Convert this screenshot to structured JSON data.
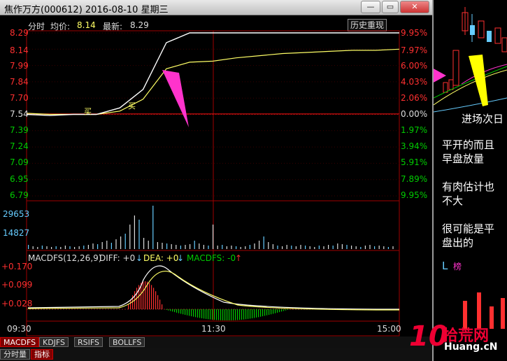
{
  "window": {
    "title": "焦作万方(000612) 2016-08-10 星期三",
    "minimize_label": "—",
    "restore_label": "▭",
    "close_label": "✕"
  },
  "header": {
    "label": "分时",
    "avg_label": "均价:",
    "avg_value": "8.14",
    "last_label": "最新:",
    "last_value": "8.29",
    "history_button": "历史重现"
  },
  "price_axis": {
    "left": [
      "8.29",
      "8.14",
      "7.99",
      "7.84",
      "7.70",
      "7.54",
      "7.39",
      "7.24",
      "7.09",
      "6.95",
      "6.79"
    ],
    "right": [
      "9.95%",
      "7.97%",
      "6.00%",
      "4.03%",
      "2.06%",
      "0.00%",
      "1.97%",
      "3.94%",
      "5.91%",
      "7.89%",
      "9.95%"
    ]
  },
  "volume_axis": [
    "29653",
    "14827"
  ],
  "macd": {
    "title": "MACDFS(12,26,9)",
    "diff_label": "DIFF: +0",
    "dea_label": "DEA: +0",
    "macdfs_label": "MACDFS: -0",
    "axis": [
      "+0.170",
      "+0.099",
      "+0.028"
    ]
  },
  "time_axis": [
    "09:30",
    "11:30",
    "15:00"
  ],
  "markers": [
    "买",
    "买"
  ],
  "indicator_tabs": [
    "MACDFS",
    "KDJFS",
    "RSIFS",
    "BOLLFS"
  ],
  "bottom_tabs": [
    "分时量",
    "指标"
  ],
  "annotations": {
    "entry_next_day": "进场次日",
    "flat_open_1": "平开的而且",
    "flat_open_2": "早盘放量",
    "meat_1": "有肉估计也",
    "meat_2": "不大",
    "likely_1": "很可能是平",
    "likely_2": "盘出的",
    "side_letter": "L",
    "side_tag": "榜"
  },
  "watermark": {
    "number": "10",
    "brand": "拾荒网",
    "site": "Huang.cN"
  },
  "colors": {
    "price_line": "#ffffff",
    "avg_line": "#ffff66",
    "up": "#ff3030",
    "down": "#00cc00",
    "axis_red": "#ff3030",
    "axis_green": "#00cc00",
    "arrow": "#ff33cc",
    "yellow_arrow": "#ffff00",
    "volume_cyan": "#66ccff"
  },
  "chart_data": {
    "type": "line",
    "title": "",
    "xlabel": "",
    "ylabel": "",
    "x": [
      "09:30",
      "09:45",
      "10:00",
      "10:15",
      "10:30",
      "10:45",
      "11:00",
      "11:15",
      "11:30",
      "13:15",
      "13:30",
      "13:45",
      "14:00",
      "14:15",
      "14:30",
      "14:45",
      "15:00"
    ],
    "series": [
      {
        "values": [
          7.54,
          7.53,
          7.54,
          7.54,
          7.6,
          7.77,
          8.2,
          8.29,
          8.29,
          8.29,
          8.29,
          8.29,
          8.29,
          8.29,
          8.29,
          8.29,
          8.29
        ]
      },
      {
        "values": [
          7.55,
          7.54,
          7.54,
          7.54,
          7.57,
          7.68,
          7.96,
          8.02,
          8.03,
          8.06,
          8.08,
          8.1,
          8.11,
          8.12,
          8.13,
          8.13,
          8.14
        ]
      }
    ],
    "ylim": [
      6.79,
      8.29
    ]
  }
}
